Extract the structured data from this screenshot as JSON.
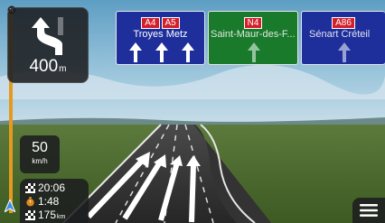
{
  "maneuver": {
    "icon": "keep-left-arrow-icon",
    "distance_value": "400",
    "distance_unit": "m"
  },
  "signposts": [
    {
      "color": "#1e2f9c",
      "roads": [
        "A4",
        "A5"
      ],
      "destinations": "Troyes  Metz",
      "arrows": 3,
      "highlighted": true
    },
    {
      "color": "#187a2a",
      "roads": [
        "N4"
      ],
      "destinations": "Saint-Maur-des-F...",
      "arrows": 1,
      "highlighted": false
    },
    {
      "color": "#1e2f9c",
      "roads": [
        "A86"
      ],
      "destinations": "Sénart  Créteil",
      "arrows": 1,
      "highlighted": false
    }
  ],
  "speed": {
    "value": "50",
    "unit": "km/h"
  },
  "trip": {
    "eta": "20:06",
    "time_left": "1:48",
    "distance_left": "175",
    "distance_unit": "km"
  },
  "menu": {
    "icon": "menu-icon"
  },
  "colors": {
    "route_progress": "#e59a1e",
    "road_sign_blue": "#1e2f9c",
    "road_sign_green": "#187a2a",
    "road_badge_red": "#d2202b"
  }
}
